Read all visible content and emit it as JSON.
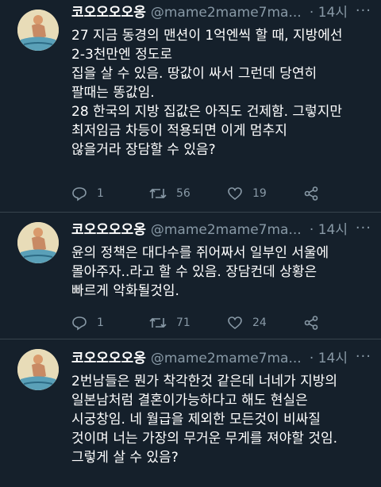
{
  "colors": {
    "background": "#15202b",
    "text": "#ffffff",
    "muted": "#8899a6",
    "divider": "#38444d"
  },
  "tweets": [
    {
      "name": "코오오오오옹",
      "handle": "@mame2mame7ma...",
      "time": "· 14시",
      "lines": [
        "27 지금 동경의 맨션이 1억엔씩 할 때, 지방에선",
        "2-3천만엔 정도로",
        "집을 살 수 있음. 땅값이 싸서 그런데 당연히",
        "팔때는 똥값임.",
        "28 한국의 지방 집값은 아직도 건제함. 그렇지만",
        "최저임금 차등이 적용되면 이게 멈추지",
        "않을거라 장담할 수 있음?"
      ],
      "replies": "1",
      "retweets": "56",
      "likes": "19"
    },
    {
      "name": "코오오오오옹",
      "handle": "@mame2mame7ma...",
      "time": "· 14시",
      "lines": [
        "윤의 정책은 대다수를 쥐어짜서 일부인 서울에",
        "몰아주자..라고 할 수 있음. 장담컨데 상황은",
        "빠르게 악화될것임."
      ],
      "replies": "1",
      "retweets": "71",
      "likes": "24"
    },
    {
      "name": "코오오오오옹",
      "handle": "@mame2mame7ma...",
      "time": "· 14시",
      "lines": [
        "2번남들은 뭔가 착각한것 같은데 너네가 지방의",
        "일본남처럼 결혼이가능하다고 해도 현실은",
        "시궁창임. 네 월급을 제외한 모든것이 비싸질",
        "것이며 너는 가장의 무거운 무게를 져야할 것임.",
        "그렇게 살 수 있음?"
      ]
    }
  ]
}
